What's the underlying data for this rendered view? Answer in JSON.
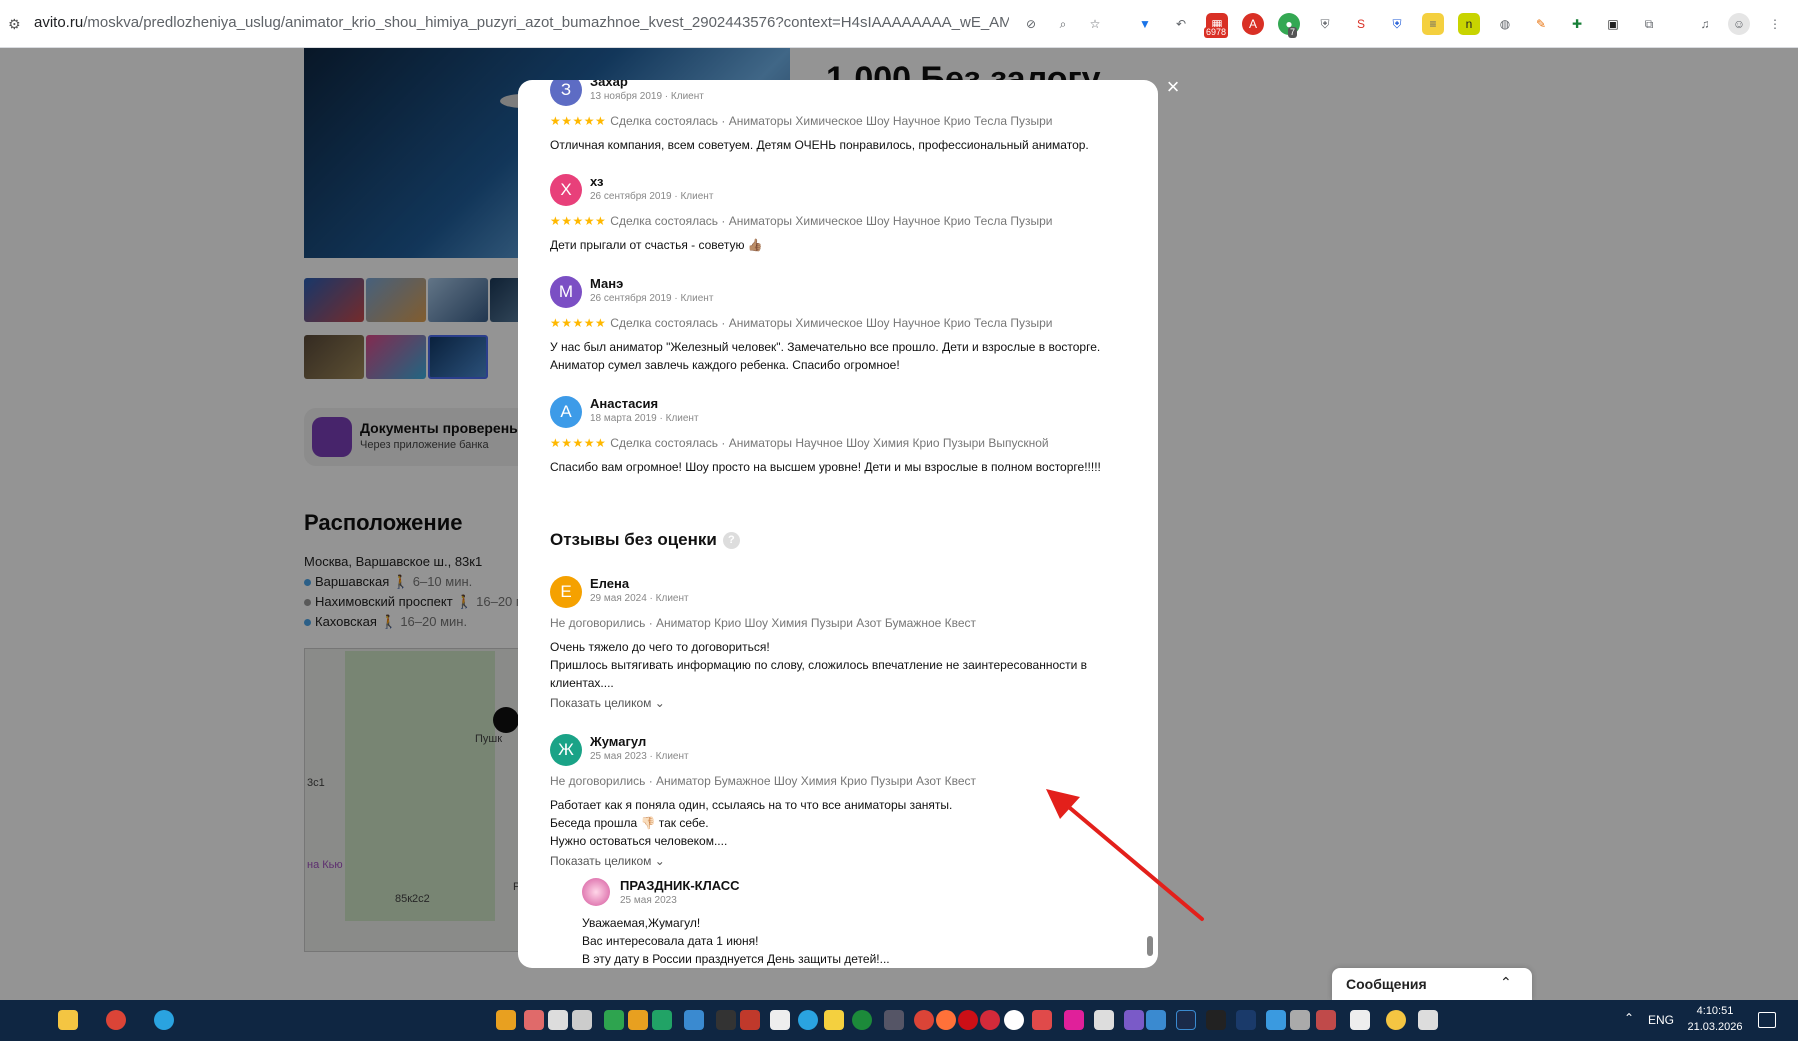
{
  "browser": {
    "url_host": "avito.ru",
    "url_path": "/moskva/predlozheniya_uslug/animator_krio_shou_himiya_puzyri_azot_bumazhnoe_kvest_2902443576?context=H4sIAAAAAAAA_wE_AMD_YToyOntz...",
    "badge_6978": "6978",
    "badge_7": "7"
  },
  "listing": {
    "price": "1 000 Без залогу",
    "docs_title": "Документы проверены",
    "docs_subtitle": "Через приложение банка",
    "location_title": "Расположение",
    "address": "Москва, Варшавское ш., 83к1",
    "metro": [
      {
        "name": "Варшавская",
        "walk": "6–10 мин.",
        "color": "#4aa4e8"
      },
      {
        "name": "Нахимовский проспект",
        "walk": "16–20 м",
        "color": "#999999"
      },
      {
        "name": "Каховская",
        "walk": "16–20 мин.",
        "color": "#4aa4e8"
      }
    ],
    "map_labels": [
      "Пушк",
      "3с1",
      "на Кью",
      "85к2с2",
      "Р"
    ]
  },
  "modal": {
    "reviews": [
      {
        "initial": "З",
        "name": "Захар",
        "date": "13 ноября 2019 · Клиент",
        "stars": "★★★★★",
        "meta": "Сделка состоялась · Аниматоры Химическое Шоу Научное Крио Тесла Пузыри",
        "text": "Отличная компания, всем советуем. Детям ОЧЕНЬ понравилось, профессиональный аниматор.",
        "color": "#5d6cc4"
      },
      {
        "initial": "Х",
        "name": "хз",
        "date": "26 сентября 2019 · Клиент",
        "stars": "★★★★★",
        "meta": "Сделка состоялась · Аниматоры Химическое Шоу Научное Крио Тесла Пузыри",
        "text": "Дети прыгали от счастья - советую 👍🏽",
        "color": "#e8407a"
      },
      {
        "initial": "М",
        "name": "Манэ",
        "date": "26 сентября 2019 · Клиент",
        "stars": "★★★★★",
        "meta": "Сделка состоялась · Аниматоры Химическое Шоу Научное Крио Тесла Пузыри",
        "text": "У нас был аниматор \"Железный человек\". Замечательно все прошло. Дети и взрослые в восторге. Аниматор сумел завлечь каждого ребенка. Спасибо огромное!",
        "color": "#7b4fc4"
      },
      {
        "initial": "А",
        "name": "Анастасия",
        "date": "18 марта 2019 · Клиент",
        "stars": "★★★★★",
        "meta": "Сделка состоялась · Аниматоры Научное Шоу Химия Крио Пузыри Выпускной",
        "text": "Спасибо вам огромное! Шоу просто на высшем уровне! Дети и мы взрослые в полном восторге!!!!!",
        "color": "#3d9be8"
      }
    ],
    "section_title": "Отзывы без оценки",
    "help_icon": "?",
    "unrated": [
      {
        "initial": "Е",
        "name": "Елена",
        "date": "29 мая 2024 · Клиент",
        "meta": "Не договорились · Аниматор Крио Шоу Химия Пузыри Азот Бумажное Квест",
        "text": "Очень тяжело до чего то договориться!\nПришлось вытягивать информацию по слову, сложилось впечатление не заинтересованности в клиентах....",
        "show_more": "Показать целиком ⌄",
        "color": "#f5a100"
      },
      {
        "initial": "Ж",
        "name": "Жумагул",
        "date": "25 мая 2023 · Клиент",
        "meta": "Не договорились · Аниматор Бумажное Шоу Химия Крио Пузыри Азот Квест",
        "text": "Работает как я поняла один, ссылаясь на то что все аниматоры заняты.\nБеседа прошла 👎🏻 так себе.\nНужно остоваться человеком....",
        "show_more": "Показать целиком ⌄",
        "color": "#1aa387"
      }
    ],
    "reply": {
      "name": "ПРАЗДНИК-КЛАСС",
      "date": "25 мая 2023",
      "text": "Уважаемая,Жумагул!\nВас интересовала дата 1 июня!\nВ эту дату в России празднуется День защиты детей!..."
    }
  },
  "messages_widget": {
    "label": "Сообщения"
  },
  "taskbar": {
    "lang": "ENG",
    "time": "4:10:51",
    "date": "21.03.2026"
  },
  "colors": {
    "accent": "#ffb800",
    "arrow": "#e3201b",
    "taskbar": "#0f2642"
  }
}
